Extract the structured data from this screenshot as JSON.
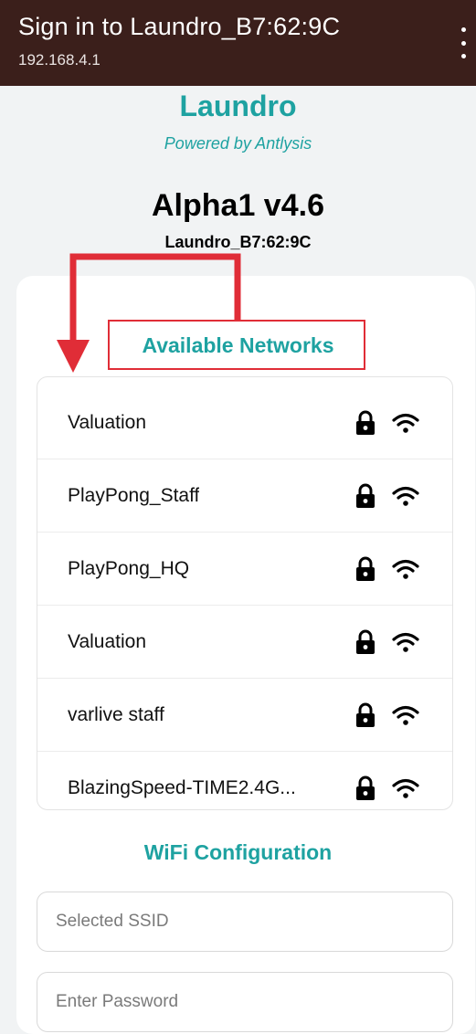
{
  "window": {
    "title": "Sign in to Laundro_B7:62:9C",
    "address": "192.168.4.1"
  },
  "header": {
    "brand": "Laundro",
    "tagline": "Powered by Antlysis",
    "device_title": "Alpha1 v4.6",
    "device_id": "Laundro_B7:62:9C"
  },
  "networks": {
    "heading": "Available Networks",
    "items": [
      {
        "ssid": "Valuation",
        "secured": true,
        "icon": "lock-icon",
        "signal_icon": "wifi-icon"
      },
      {
        "ssid": "PlayPong_Staff",
        "secured": true,
        "icon": "lock-icon",
        "signal_icon": "wifi-icon"
      },
      {
        "ssid": "PlayPong_HQ",
        "secured": true,
        "icon": "lock-icon",
        "signal_icon": "wifi-icon"
      },
      {
        "ssid": "Valuation",
        "secured": true,
        "icon": "lock-icon",
        "signal_icon": "wifi-icon"
      },
      {
        "ssid": "varlive staff",
        "secured": true,
        "icon": "lock-icon",
        "signal_icon": "wifi-icon"
      },
      {
        "ssid": "BlazingSpeed-TIME2.4G...",
        "secured": true,
        "icon": "lock-icon",
        "signal_icon": "wifi-icon"
      }
    ]
  },
  "wifi_config": {
    "heading": "WiFi Configuration",
    "ssid_placeholder": "Selected SSID",
    "ssid_value": "",
    "password_placeholder": "Enter Password",
    "password_value": ""
  },
  "colors": {
    "topbar": "#3b1f1b",
    "accent": "#1ea2a1",
    "annotation": "#e02d37",
    "background": "#f1f3f4"
  }
}
